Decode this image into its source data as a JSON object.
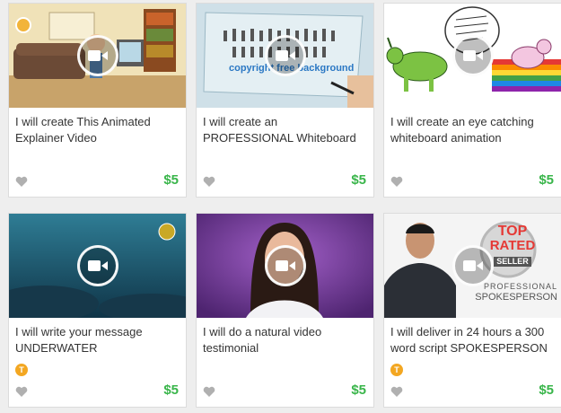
{
  "cards": [
    {
      "title": "I will create This Animated Explainer Video",
      "price": "$5",
      "badge": null
    },
    {
      "title": "I will create an PROFESSIONAL Whiteboard",
      "price": "$5",
      "badge": null,
      "thumb_text": "copyright free background"
    },
    {
      "title": "I will create an eye catching whiteboard animation",
      "price": "$5",
      "badge": null
    },
    {
      "title": "I will write your message UNDERWATER",
      "price": "$5",
      "badge": "T"
    },
    {
      "title": "I will do a natural video testimonial",
      "price": "$5",
      "badge": null
    },
    {
      "title": "I will deliver in 24 hours a 300 word script SPOKESPERSON",
      "price": "$5",
      "badge": "T",
      "thumb_text": [
        "TOP",
        "RATED",
        "SELLER",
        "PROFESSIONAL",
        "SPOKESPERSON"
      ]
    }
  ],
  "icons": {
    "play": "video-camera-icon",
    "favorite": "heart-icon",
    "badge": "top-rated-badge-icon"
  },
  "colors": {
    "price": "#39b54a",
    "badge": "#f3a722",
    "heart": "#b0b0b0"
  }
}
